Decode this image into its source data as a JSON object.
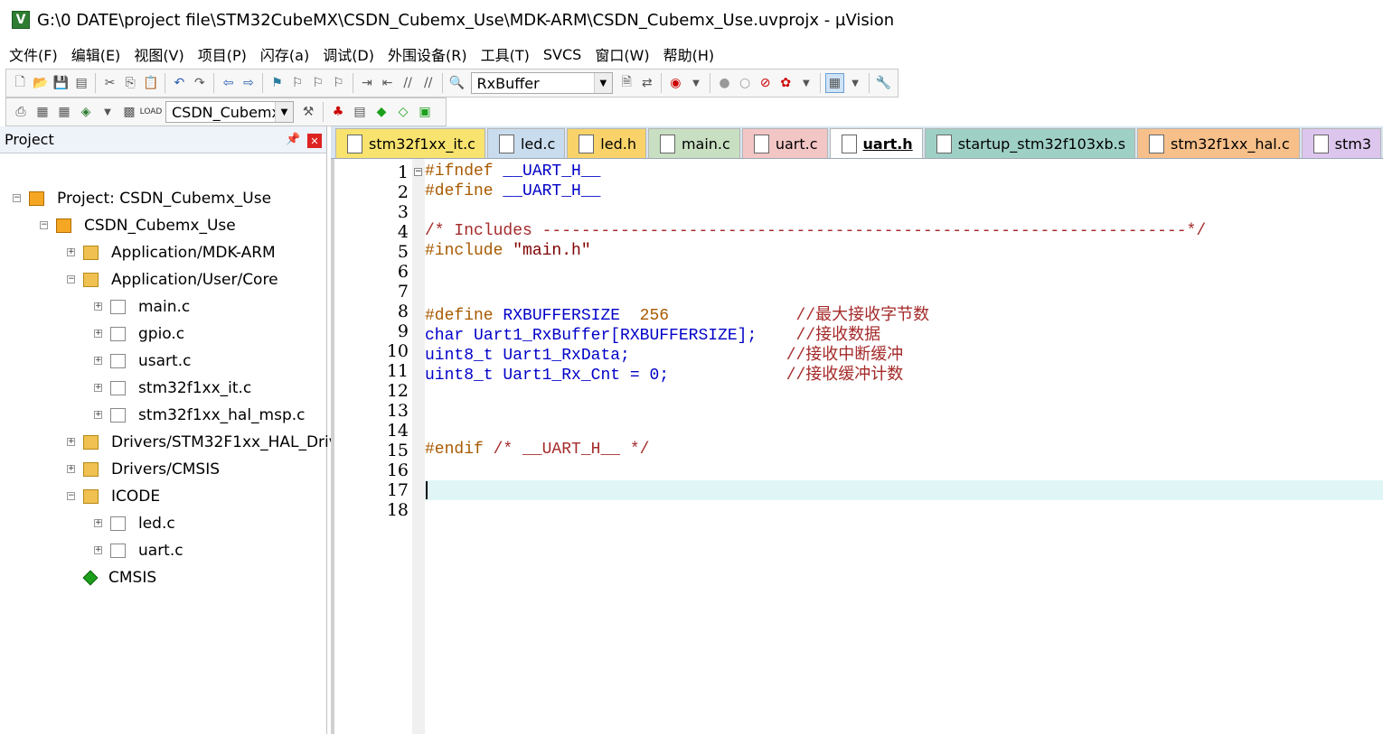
{
  "window": {
    "title": "G:\\0 DATE\\project file\\STM32CubeMX\\CSDN_Cubemx_Use\\MDK-ARM\\CSDN_Cubemx_Use.uvprojx - µVision",
    "app_icon": "uvision-icon"
  },
  "menu": [
    "文件(F)",
    "编辑(E)",
    "视图(V)",
    "项目(P)",
    "闪存(a)",
    "调试(D)",
    "外围设备(R)",
    "工具(T)",
    "SVCS",
    "窗口(W)",
    "帮助(H)"
  ],
  "toolbar1": {
    "find_combo": "RxBuffer"
  },
  "toolbar2": {
    "target_combo": "CSDN_Cubemx"
  },
  "project_panel": {
    "title": "Project",
    "tree": [
      {
        "label": "Project: CSDN_Cubemx_Use",
        "icon": "project-icon"
      },
      {
        "label": "CSDN_Cubemx_Use",
        "icon": "target-icon"
      },
      {
        "label": "Application/MDK-ARM",
        "icon": "folder-icon"
      },
      {
        "label": "Application/User/Core",
        "icon": "folder-icon"
      },
      {
        "label": "main.c",
        "icon": "file-icon"
      },
      {
        "label": "gpio.c",
        "icon": "file-icon"
      },
      {
        "label": "usart.c",
        "icon": "file-icon"
      },
      {
        "label": "stm32f1xx_it.c",
        "icon": "file-icon"
      },
      {
        "label": "stm32f1xx_hal_msp.c",
        "icon": "file-icon"
      },
      {
        "label": "Drivers/STM32F1xx_HAL_Driv",
        "icon": "folder-icon"
      },
      {
        "label": "Drivers/CMSIS",
        "icon": "folder-icon"
      },
      {
        "label": "ICODE",
        "icon": "folder-icon"
      },
      {
        "label": "led.c",
        "icon": "file-icon"
      },
      {
        "label": "uart.c",
        "icon": "file-icon"
      },
      {
        "label": "CMSIS",
        "icon": "cmsis-gem-icon"
      }
    ]
  },
  "tabs": [
    {
      "label": "stm32f1xx_it.c",
      "color": "#f7e36e"
    },
    {
      "label": "led.c",
      "color": "#c9dcee"
    },
    {
      "label": "led.h",
      "color": "#f9d36a"
    },
    {
      "label": "main.c",
      "color": "#c8dfc2"
    },
    {
      "label": "uart.c",
      "color": "#f3c6c6"
    },
    {
      "label": "uart.h",
      "color": "#ffffff"
    },
    {
      "label": "startup_stm32f103xb.s",
      "color": "#9fd0c6"
    },
    {
      "label": "stm32f1xx_hal.c",
      "color": "#f7c08a"
    },
    {
      "label": "stm3",
      "color": "#ddc6ee"
    }
  ],
  "editor": {
    "line_numbers": [
      "1",
      "2",
      "3",
      "4",
      "5",
      "6",
      "7",
      "8",
      "9",
      "10",
      "11",
      "12",
      "13",
      "14",
      "15",
      "16",
      "17",
      "18"
    ],
    "current_line": 17,
    "lines": [
      [
        {
          "t": "#ifndef ",
          "c": "pp"
        },
        {
          "t": "__UART_H__",
          "c": "id"
        }
      ],
      [
        {
          "t": "#define ",
          "c": "pp"
        },
        {
          "t": "__UART_H__",
          "c": "id"
        }
      ],
      [],
      [
        {
          "t": "/* Includes ------------------------------------------------------------------*/",
          "c": "cm"
        }
      ],
      [
        {
          "t": "#include ",
          "c": "pp"
        },
        {
          "t": "\"main.h\"",
          "c": "str"
        }
      ],
      [],
      [],
      [
        {
          "t": "#define ",
          "c": "pp"
        },
        {
          "t": "RXBUFFERSIZE  ",
          "c": "id"
        },
        {
          "t": "256",
          "c": "num"
        },
        {
          "t": "             ",
          "c": "pp"
        },
        {
          "t": "//最大接收字节数",
          "c": "cm"
        }
      ],
      [
        {
          "t": "char ",
          "c": "ty"
        },
        {
          "t": "Uart1_RxBuffer[RXBUFFERSIZE];",
          "c": "id"
        },
        {
          "t": "    ",
          "c": "pp"
        },
        {
          "t": "//接收数据",
          "c": "cm"
        }
      ],
      [
        {
          "t": "uint8_t ",
          "c": "ty"
        },
        {
          "t": "Uart1_RxData;",
          "c": "id"
        },
        {
          "t": "                ",
          "c": "pp"
        },
        {
          "t": "//接收中断缓冲",
          "c": "cm"
        }
      ],
      [
        {
          "t": "uint8_t ",
          "c": "ty"
        },
        {
          "t": "Uart1_Rx_Cnt = 0;",
          "c": "id"
        },
        {
          "t": "            ",
          "c": "pp"
        },
        {
          "t": "//接收缓冲计数",
          "c": "cm"
        }
      ],
      [],
      [],
      [],
      [
        {
          "t": "#endif ",
          "c": "pp"
        },
        {
          "t": "/* __UART_H__ */",
          "c": "cm"
        }
      ],
      [],
      [],
      []
    ]
  }
}
